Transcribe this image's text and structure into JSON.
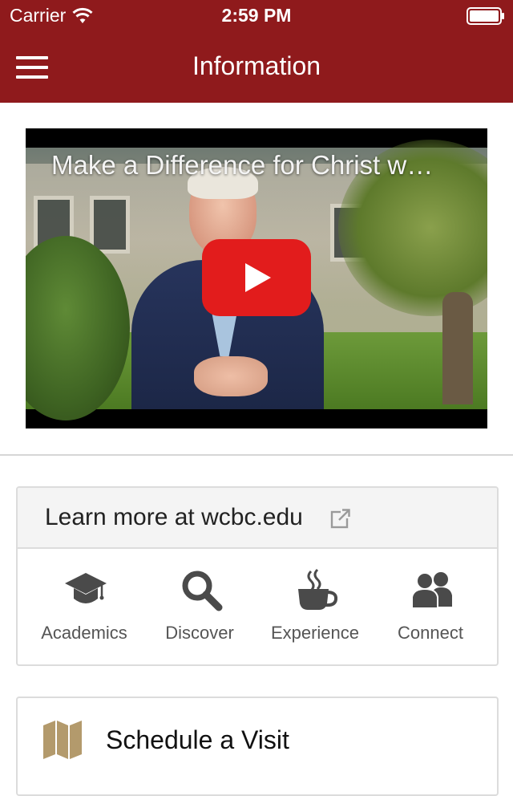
{
  "status_bar": {
    "carrier": "Carrier",
    "time": "2:59 PM",
    "wifi_icon": "wifi-icon",
    "battery_icon": "battery-full-icon"
  },
  "nav_bar": {
    "title": "Information",
    "menu_icon": "hamburger-menu-icon",
    "background_color": "#8f1a1c"
  },
  "video": {
    "title": "Make a Difference for Christ w…",
    "play_icon": "youtube-play-icon",
    "play_color": "#e21c1c"
  },
  "learn_more": {
    "label": "Learn more at wcbc.edu",
    "icon": "external-link-icon",
    "tiles": [
      {
        "label": "Academics",
        "icon": "graduation-cap-icon"
      },
      {
        "label": "Discover",
        "icon": "search-icon"
      },
      {
        "label": "Experience",
        "icon": "coffee-cup-icon"
      },
      {
        "label": "Connect",
        "icon": "users-icon"
      }
    ]
  },
  "visit": {
    "label": "Schedule a Visit",
    "icon": "map-icon",
    "icon_color": "#b39a6c"
  }
}
